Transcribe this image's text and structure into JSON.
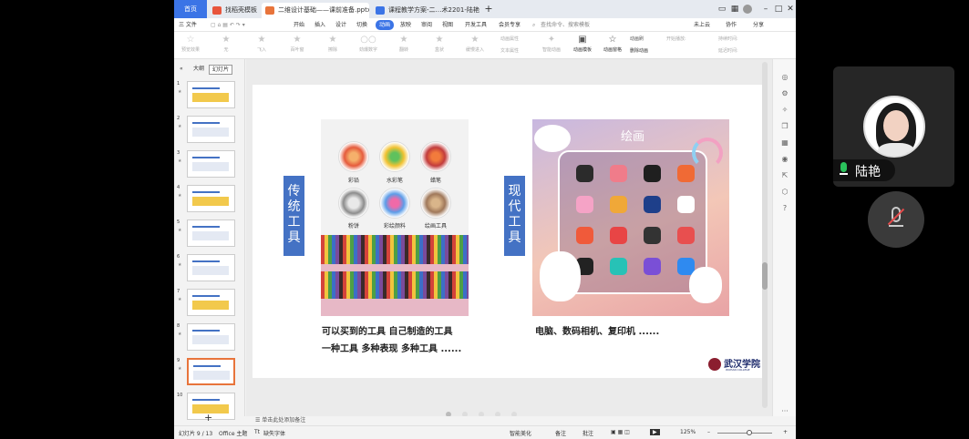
{
  "tabs": {
    "home": "首页",
    "tab1": "找稻壳模板",
    "tab2": "二维设计基础——课前准备.pptx",
    "tab3": "课程教学方案-二…术2201-陆艳"
  },
  "menu": [
    "三 文件",
    "开始",
    "插入",
    "设计",
    "切换",
    "动画",
    "放映",
    "审阅",
    "视图",
    "开发工具",
    "会员专享"
  ],
  "menu_active": "动画",
  "search_hint": "查找命令、搜索模板",
  "menu_right": {
    "cloud": "未上云",
    "collab": "协作",
    "share": "分享"
  },
  "ribbon": {
    "preview": "预览效果",
    "effects": [
      "无",
      "飞入",
      "百叶窗",
      "擦除",
      "劲爆数字",
      "翻转",
      "盒状",
      "缓慢进入"
    ],
    "attr1": "动画属性",
    "attr2": "文本属性",
    "smart": "智能动画",
    "template": "动画模板",
    "painter": "动画窗格",
    "pane": "动画刷",
    "delete": "删除动画",
    "start": "开始播放:",
    "duration": "持续时间:",
    "delay": "延迟时间:"
  },
  "left_tabs": {
    "outline": "大纲",
    "slides": "幻灯片"
  },
  "slides": [
    {
      "n": "1",
      "title": "二维设计基础"
    },
    {
      "n": "2",
      "title": ""
    },
    {
      "n": "3",
      "title": ""
    },
    {
      "n": "4",
      "title": ""
    },
    {
      "n": "5",
      "title": ""
    },
    {
      "n": "6",
      "title": ""
    },
    {
      "n": "7",
      "title": ""
    },
    {
      "n": "8",
      "title": ""
    },
    {
      "n": "9",
      "title": ""
    },
    {
      "n": "10",
      "title": ""
    }
  ],
  "slide_content": {
    "label_left": "传统工具",
    "label_right": "现代工具",
    "tools": [
      "彩铅",
      "水彩笔",
      "蜡笔",
      "粉饼",
      "彩绘颜料",
      "绘画工具"
    ],
    "panel_title": "绘画",
    "caption_left_1": "可以买到的工具 自己制造的工具",
    "caption_left_2": "一种工具  多种表现 多种工具  ......",
    "caption_right": "电脑、数码相机、复印机 ......",
    "logo_text": "武汉学院",
    "logo_sub": "WUHAN COLLEGE"
  },
  "notes_hint": "单击此处添加备注",
  "status": {
    "slide_counter": "幻灯片 9 / 13",
    "theme": "Office 主题",
    "font_warn": "缺失字体",
    "smart_beautify": "智能美化",
    "notes": "备注",
    "comments": "批注",
    "zoom": "125%"
  },
  "participant": {
    "name": "陆艳"
  },
  "colors": {
    "accent": "#3b74e6",
    "label_blue": "#4472c4",
    "thumb_selected": "#e8743b"
  }
}
